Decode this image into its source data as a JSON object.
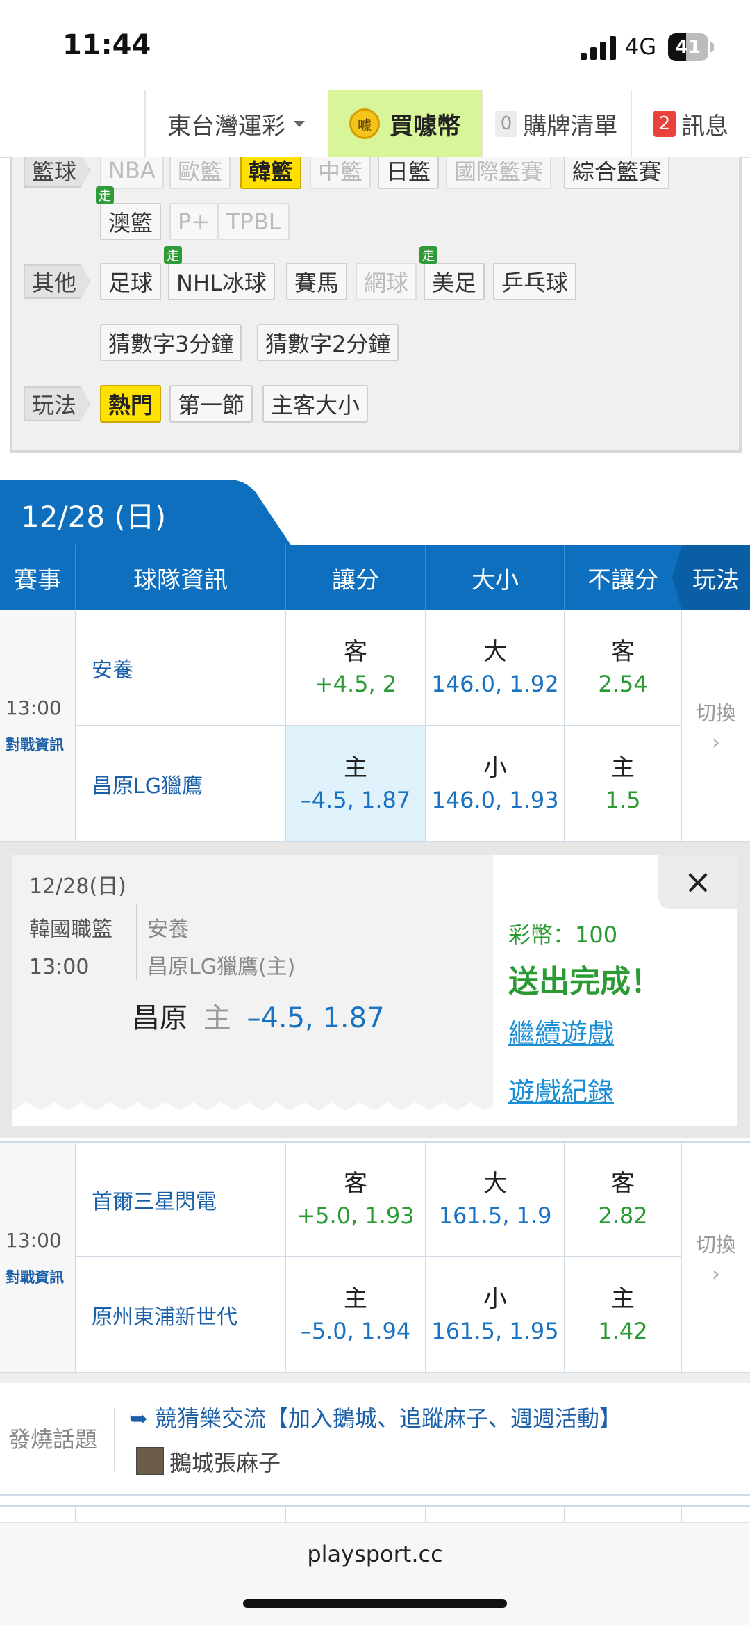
{
  "status_bar": {
    "time": "11:44",
    "network": "4G",
    "battery": "41"
  },
  "nav": {
    "lottery": "東台灣運彩",
    "coins_label": "買噱幣",
    "coins_icon_text": "噱",
    "cart_count": "0",
    "cart_label": "購牌清單",
    "msg_count": "2",
    "msg_label": "訊息"
  },
  "filters": {
    "basketball_label": "籃球",
    "basketball_row1": [
      "NBA",
      "歐籃",
      "韓籃",
      "中籃",
      "日籃",
      "國際籃賽",
      "綜合籃賽"
    ],
    "basketball_row2": [
      "澳籃",
      "P+",
      "TPBL"
    ],
    "other_label": "其他",
    "other_row1": [
      "足球",
      "NHL冰球",
      "賽馬",
      "網球",
      "美足",
      "乒乓球"
    ],
    "other_row2": [
      "猜數字3分鐘",
      "猜數字2分鐘"
    ],
    "play_label": "玩法",
    "play_items": [
      "熱門",
      "第一節",
      "主客大小"
    ],
    "walk_badge": "走"
  },
  "date_tab": "12/28 (日)",
  "table_header": {
    "match": "賽事",
    "team": "球隊資訊",
    "spread": "讓分",
    "total": "大小",
    "moneyline": "不讓分",
    "play": "玩法"
  },
  "games": [
    {
      "time": "13:00",
      "vs_label": "對戰資訊",
      "away": {
        "team": "安養",
        "spread_side": "客",
        "spread": "+4.5, 2",
        "total_side": "大",
        "total": "146.0, 1.92",
        "ml_side": "客",
        "ml": "2.54"
      },
      "home": {
        "team": "昌原LG獵鷹",
        "spread_side": "主",
        "spread": "–4.5, 1.87",
        "total_side": "小",
        "total": "146.0, 1.93",
        "ml_side": "主",
        "ml": "1.5"
      },
      "switch_label": "切換"
    },
    {
      "time": "13:00",
      "vs_label": "對戰資訊",
      "away": {
        "team": "首爾三星閃電",
        "spread_side": "客",
        "spread": "+5.0, 1.93",
        "total_side": "大",
        "total": "161.5, 1.9",
        "ml_side": "客",
        "ml": "2.82"
      },
      "home": {
        "team": "原州東浦新世代",
        "spread_side": "主",
        "spread": "–5.0, 1.94",
        "total_side": "小",
        "total": "161.5, 1.95",
        "ml_side": "主",
        "ml": "1.42"
      },
      "switch_label": "切換"
    }
  ],
  "ticket": {
    "date": "12/28(日)",
    "league": "韓國職籃",
    "time": "13:00",
    "away": "安養",
    "home": "昌原LG獵鷹(主)",
    "pick_team": "昌原",
    "pick_side": "主",
    "pick_odds": "–4.5, 1.87",
    "coins": "彩幣：100",
    "done": "送出完成！",
    "continue": "繼續遊戲",
    "history": "遊戲紀錄",
    "close": "×"
  },
  "hot_topic": {
    "label": "發燒話題",
    "arrow": "➥",
    "title": "競猜樂交流【加入鵝城、追蹤麻子、週週活動】",
    "author": "鵝城張麻子"
  },
  "footer": {
    "domain": "playsport.cc"
  }
}
